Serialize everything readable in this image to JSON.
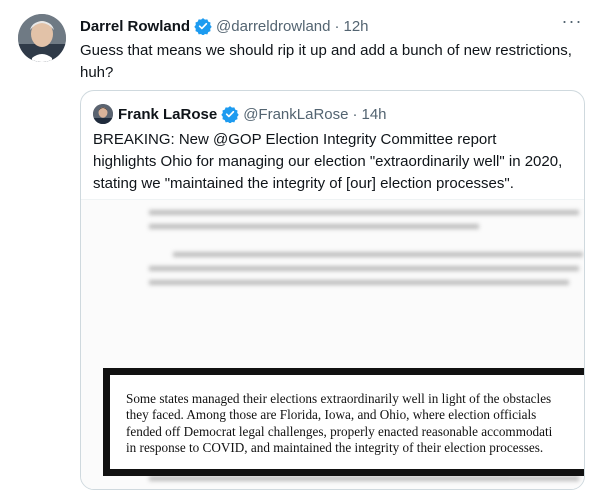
{
  "tweet": {
    "author_name": "Darrel Rowland",
    "author_handle": "@darreldrowland",
    "separator": "·",
    "time": "12h",
    "more_label": "···",
    "text": "Guess that means we should rip it up and add a bunch of new restrictions, huh?"
  },
  "quoted_tweet": {
    "author_name": "Frank LaRose",
    "author_handle": "@FrankLaRose",
    "separator": "·",
    "time": "14h",
    "text": "BREAKING: New @GOP Election Integrity Committee report highlights Ohio for managing our election \"extraordinarily well\" in 2020, stating we \"maintained the integrity of [our] election processes\".",
    "media": {
      "excerpt": "Some states managed their elections extraordinarily well in light of the obstacles\nthey faced. Among those are Florida, Iowa, and Ohio, where election officials\nfended off Democrat legal challenges, properly enacted reasonable accommodati\nin response to COVID, and maintained the integrity of their election processes."
    }
  },
  "colors": {
    "text": "#0f1419",
    "secondary": "#536471",
    "verified": "#1d9bf0",
    "border": "#cfd9de"
  },
  "icons": {
    "verified": "verified-badge-icon",
    "more": "more-options-icon"
  }
}
